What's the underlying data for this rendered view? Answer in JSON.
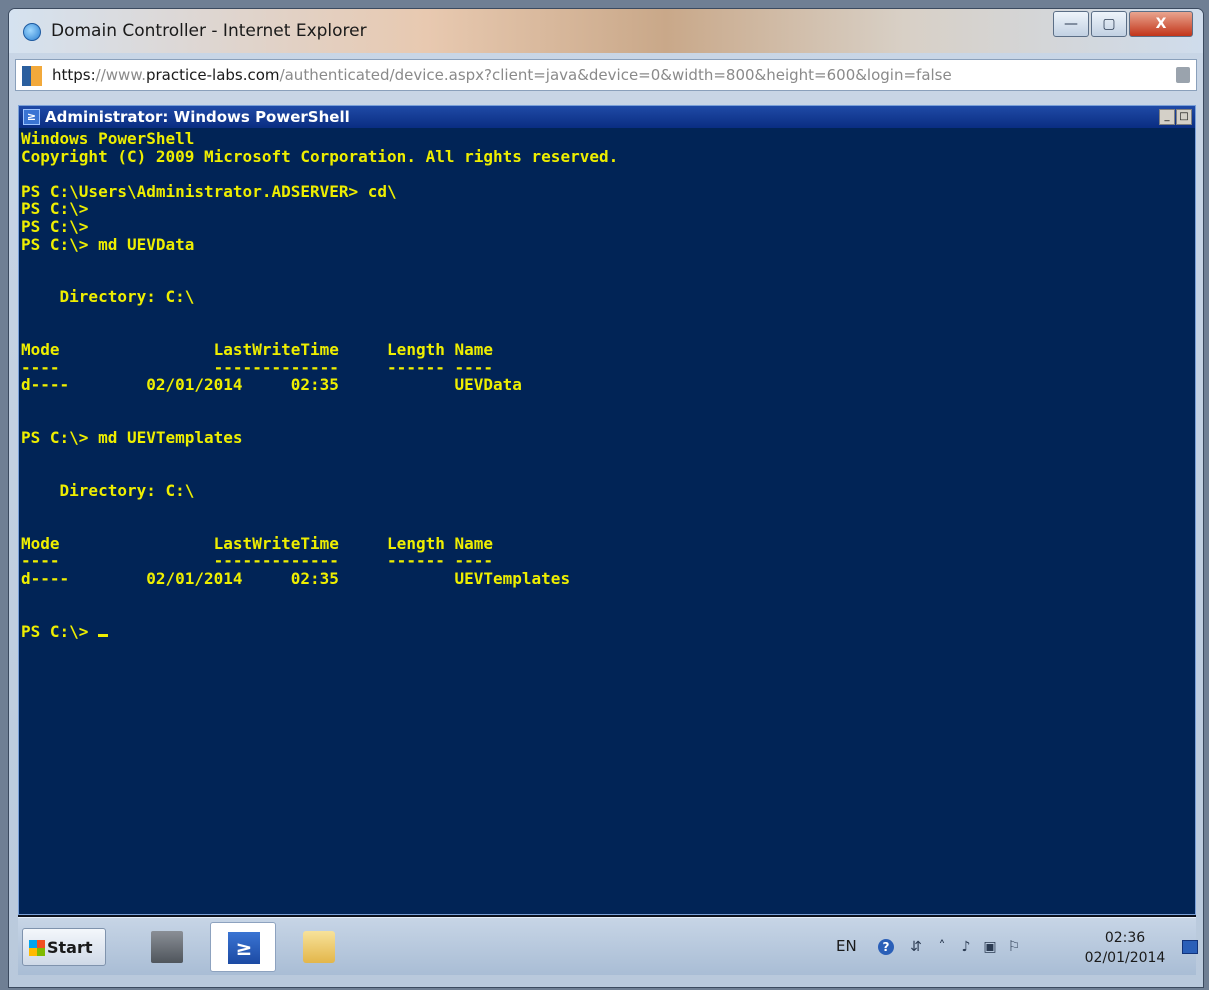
{
  "browser": {
    "title": "Domain Controller - Internet Explorer",
    "url_proto": "https:",
    "url_slashes": "//www.",
    "url_domain": "practice-labs.com",
    "url_path": "/authenticated/device.aspx?client=java&device=0&width=800&height=600&login=false"
  },
  "powershell": {
    "title": "Administrator: Windows PowerShell",
    "lines": [
      "Windows PowerShell",
      "Copyright (C) 2009 Microsoft Corporation. All rights reserved.",
      "",
      "PS C:\\Users\\Administrator.ADSERVER> cd\\",
      "PS C:\\>",
      "PS C:\\>",
      "PS C:\\> md UEVData",
      "",
      "",
      "    Directory: C:\\",
      "",
      "",
      "Mode                LastWriteTime     Length Name",
      "----                -------------     ------ ----",
      "d----        02/01/2014     02:35            UEVData",
      "",
      "",
      "PS C:\\> md UEVTemplates",
      "",
      "",
      "    Directory: C:\\",
      "",
      "",
      "Mode                LastWriteTime     Length Name",
      "----                -------------     ------ ----",
      "d----        02/01/2014     02:35            UEVTemplates",
      "",
      "",
      "PS C:\\> "
    ]
  },
  "taskbar": {
    "start_label": "Start",
    "language": "EN",
    "clock_time": "02:36",
    "clock_date": "02/01/2014"
  }
}
